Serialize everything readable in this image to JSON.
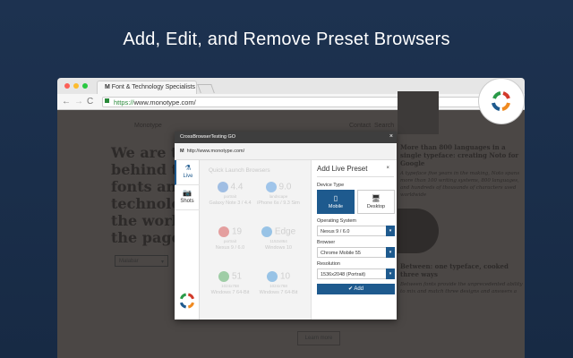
{
  "headline": "Add, Edit, and Remove Preset Browsers",
  "browser": {
    "tab_title": "Font & Technology Specialists",
    "tab_icon": "M",
    "url_scheme": "https://",
    "url_rest": "www.monotype.com/"
  },
  "site": {
    "brand": "Monotype",
    "contact": "Contact",
    "search": "Search",
    "hero": [
      "We are th",
      "behind ty",
      "fonts and",
      "technolo",
      "the world",
      "the page"
    ],
    "font_select": "Malabar",
    "article1_title": "More than 800 languages in a single typeface: creating Noto for Google",
    "article1_body": "A typeface five years in the making, Noto spans more than 100 writing systems, 800 languages, and hundreds of thousands of characters used worldwide",
    "article2_title": "Between: one typeface, cooked three ways",
    "article2_body": "Between fonts provide the unprecedented ability to mix and match three designs and answers a",
    "learn_more": "Learn more"
  },
  "modal": {
    "title": "CrossBrowserTesting GO",
    "close": "×",
    "url": "http://www.monotype.com/",
    "url_icon": "M",
    "sidebar": [
      {
        "label": "Live",
        "icon": "flask-icon"
      },
      {
        "label": "Shots",
        "icon": "camera-icon"
      }
    ],
    "quick_launch": {
      "title": "Quick Launch Browsers",
      "cards": [
        {
          "version": "4.4",
          "orientation": "portrait",
          "name": "Galaxy Note 3 / 4.4",
          "color": "#3b7fd1"
        },
        {
          "version": "9.0",
          "orientation": "landscape",
          "name": "iPhone 6s / 9.3 Sim",
          "color": "#3b8fe0"
        },
        {
          "version": "19",
          "orientation": "portrait",
          "name": "Nexus 9 / 6.0",
          "color": "#d23a3a"
        },
        {
          "version": "Edge",
          "orientation": "1152x864",
          "name": "Windows 10",
          "color": "#2a8ad8"
        },
        {
          "version": "51",
          "orientation": "1024x768",
          "name": "Windows 7 64-Bit",
          "color": "#3aa04a"
        },
        {
          "version": "10",
          "orientation": "1024x768",
          "name": "Windows 7 64-Bit",
          "color": "#2a8ad8"
        }
      ]
    },
    "preset": {
      "title": "Add Live Preset",
      "close": "×",
      "device_type_label": "Device Type",
      "mobile": "Mobile",
      "desktop": "Desktop",
      "os_label": "Operating System",
      "os_value": "Nexus 9 / 6.0",
      "browser_label": "Browser",
      "browser_value": "Chrome Mobile 55",
      "resolution_label": "Resolution",
      "resolution_value": "1536x2048 (Portrait)",
      "add": "✔ Add"
    }
  },
  "colors": {
    "accent": "#1e5a8e",
    "bg": "#1d3250"
  }
}
